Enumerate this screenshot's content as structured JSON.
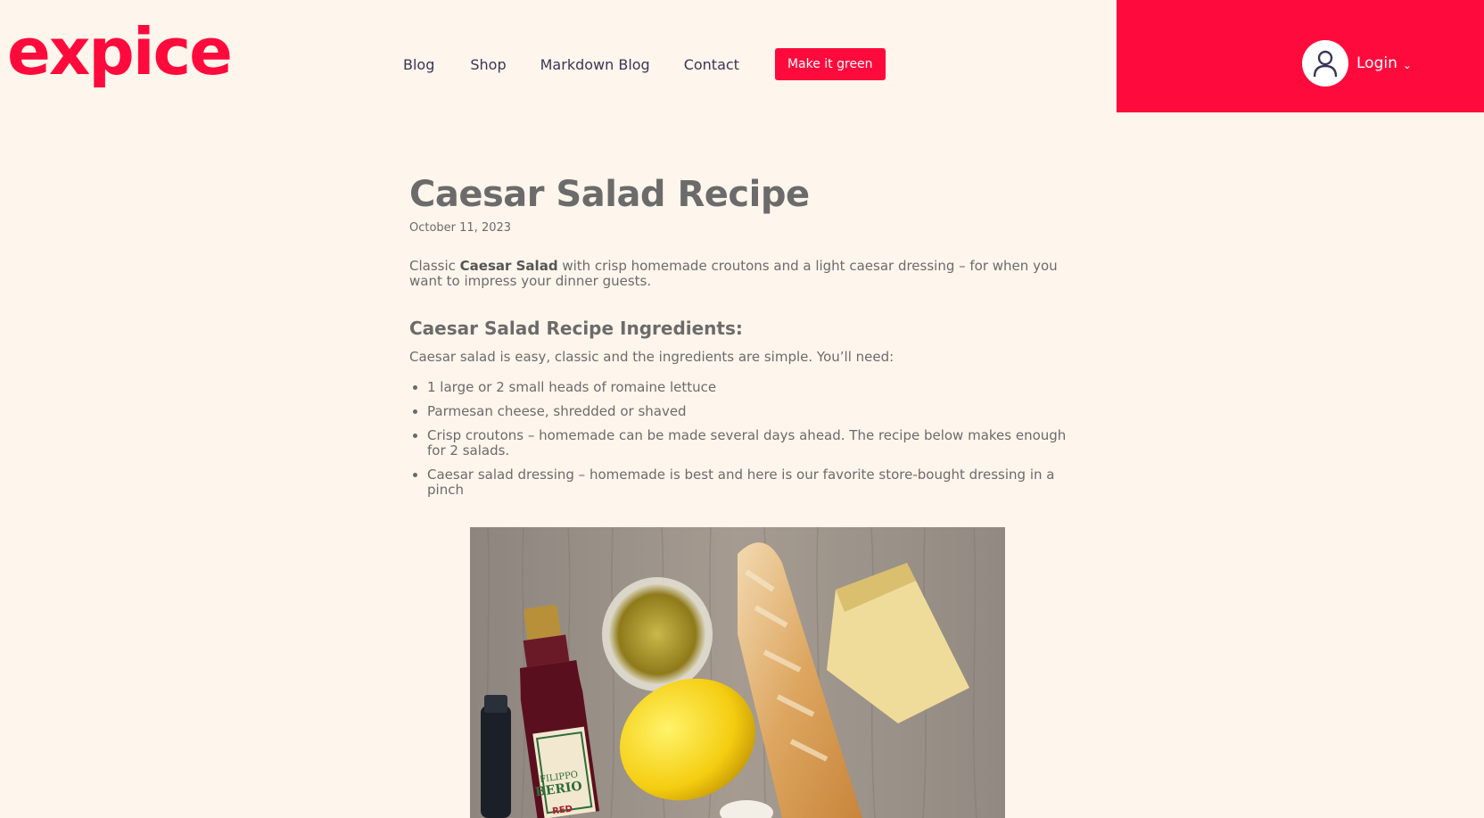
{
  "brand": {
    "logo_text": "expice",
    "accent_color": "#ff0a3c"
  },
  "nav": {
    "items": [
      {
        "label": "Blog"
      },
      {
        "label": "Shop"
      },
      {
        "label": "Markdown Blog"
      },
      {
        "label": "Contact"
      }
    ],
    "green_button_label": "Make it green"
  },
  "user": {
    "avatar_icon": "user-icon",
    "login_label": "Login",
    "chevron_icon": "chevron-down-icon"
  },
  "article": {
    "title": "Caesar Salad Recipe",
    "date": "October 11, 2023",
    "intro_prefix": "Classic ",
    "intro_bold": "Caesar Salad",
    "intro_suffix": " with crisp homemade croutons and a light caesar dressing – for when you want to impress your dinner guests.",
    "section_heading": "Caesar Salad Recipe Ingredients:",
    "section_text": "Caesar salad is easy, classic and the ingredients are simple. You’ll need:",
    "ingredients": [
      "1 large or 2 small heads of romaine lettuce",
      "Parmesan cheese, shredded or shaved",
      "Crisp croutons – homemade can be made several days ahead. The recipe below makes enough for 2 salads.",
      "Caesar salad dressing – homemade is best and here is our favorite store-bought dressing in a pinch"
    ],
    "photo_label_1": "FILIPPO",
    "photo_label_2": "BERIO",
    "photo_label_3": "RED"
  }
}
